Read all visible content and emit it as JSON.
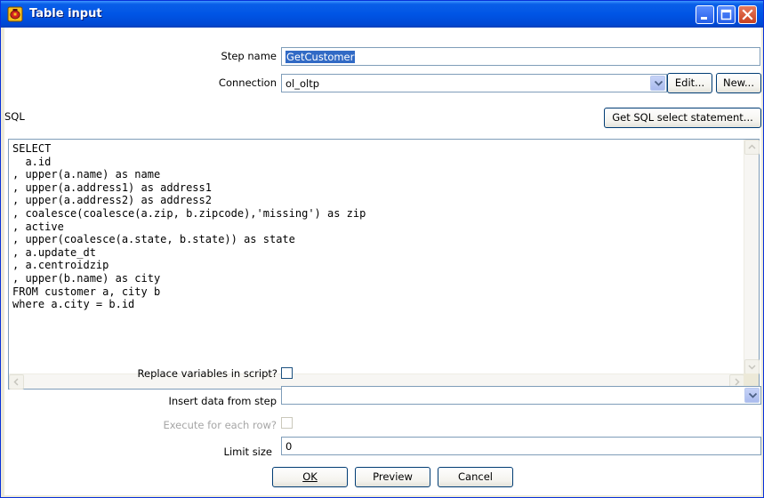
{
  "window": {
    "title": "Table input"
  },
  "form": {
    "step_name_label": "Step name",
    "step_name_value": "GetCustomer",
    "connection_label": "Connection",
    "connection_value": "ol_oltp",
    "edit_button": "Edit...",
    "new_button": "New...",
    "sql_label": "SQL",
    "get_sql_button": "Get SQL select statement...",
    "sql_text": "SELECT\n  a.id\n, upper(a.name) as name\n, upper(a.address1) as address1\n, upper(a.address2) as address2\n, coalesce(coalesce(a.zip, b.zipcode),'missing') as zip\n, active\n, upper(coalesce(a.state, b.state)) as state\n, a.update_dt\n, a.centroidzip\n, upper(b.name) as city\nFROM customer a, city b\nwhere a.city = b.id",
    "replace_variables_label": "Replace variables in script?",
    "replace_variables_checked": false,
    "insert_data_label": "Insert data from step",
    "insert_data_value": "",
    "execute_each_row_label": "Execute for each row?",
    "execute_each_row_checked": false,
    "limit_size_label": "Limit size",
    "limit_size_value": "0"
  },
  "buttons": {
    "ok": "OK",
    "preview": "Preview",
    "cancel": "Cancel"
  },
  "icons": {
    "title_icon": "spoon-kettle-icon",
    "minimize": "minimize-icon",
    "maximize": "maximize-icon",
    "close": "close-icon"
  },
  "colors": {
    "titlebar": "#0055e5",
    "selection": "#316ac5",
    "close_button": "#c9401f"
  }
}
